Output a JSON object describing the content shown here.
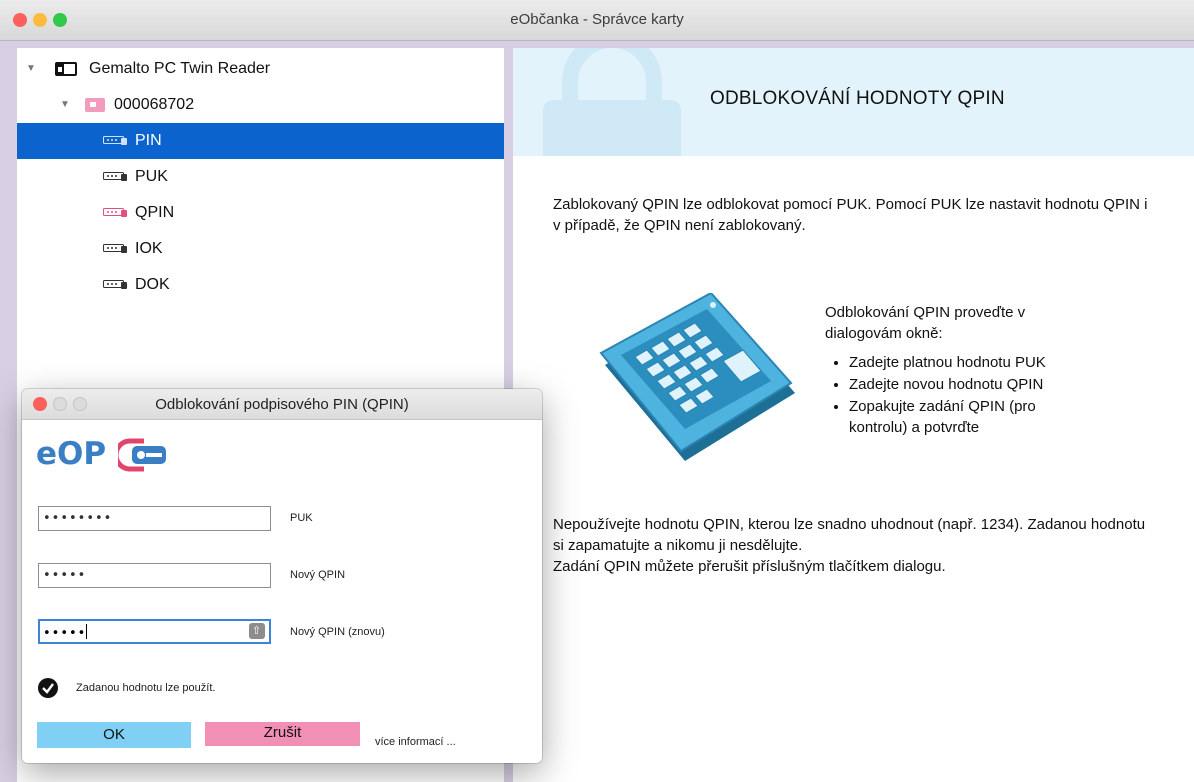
{
  "window": {
    "title": "eObčanka - Správce karty"
  },
  "tree": {
    "reader": "Gemalto PC Twin Reader",
    "card": "000068702",
    "items": [
      {
        "label": "PIN",
        "selected": true
      },
      {
        "label": "PUK",
        "selected": false
      },
      {
        "label": "QPIN",
        "selected": false
      },
      {
        "label": "IOK",
        "selected": false
      },
      {
        "label": "DOK",
        "selected": false
      }
    ]
  },
  "panel": {
    "heading": "ODBLOKOVÁNÍ HODNOTY QPIN",
    "intro": "Zablokovaný QPIN lze odblokovat pomocí PUK. Pomocí PUK lze nastavit hodnotu QPIN i v případě, že QPIN není zablokovaný.",
    "steps_title": "Odblokování QPIN proveďte v dialogovám okně:",
    "steps": [
      "Zadejte platnou hodnotu PUK",
      "Zadejte novou hodnotu QPIN",
      "Zopakujte zadání QPIN (pro kontrolu) a potvrďte"
    ],
    "warning1": "Nepoužívejte hodnotu QPIN, kterou lze snadno uhodnout (např. 1234). Zadanou hodnotu si zapamatujte a nikomu ji nesdělujte.",
    "warning2": "Zadání QPIN můžete přerušit příslušným tlačítkem dialogu."
  },
  "dialog": {
    "title": "Odblokování podpisového PIN (QPIN)",
    "logo": "eOP",
    "fields": [
      {
        "label": "PUK",
        "value": "••••••••"
      },
      {
        "label": "Nový QPIN",
        "value": "•••••"
      },
      {
        "label": "Nový QPIN (znovu)",
        "value": "•••••"
      }
    ],
    "status": "Zadanou hodnotu lze použít.",
    "ok": "OK",
    "cancel": "Zrušit",
    "more": "více informací ..."
  },
  "colors": {
    "selection": "#0b63ce",
    "ok_button": "#7fd0f4",
    "cancel_button": "#f18fb4",
    "logo_blue": "#3a7fc4",
    "logo_red": "#e0456e"
  }
}
